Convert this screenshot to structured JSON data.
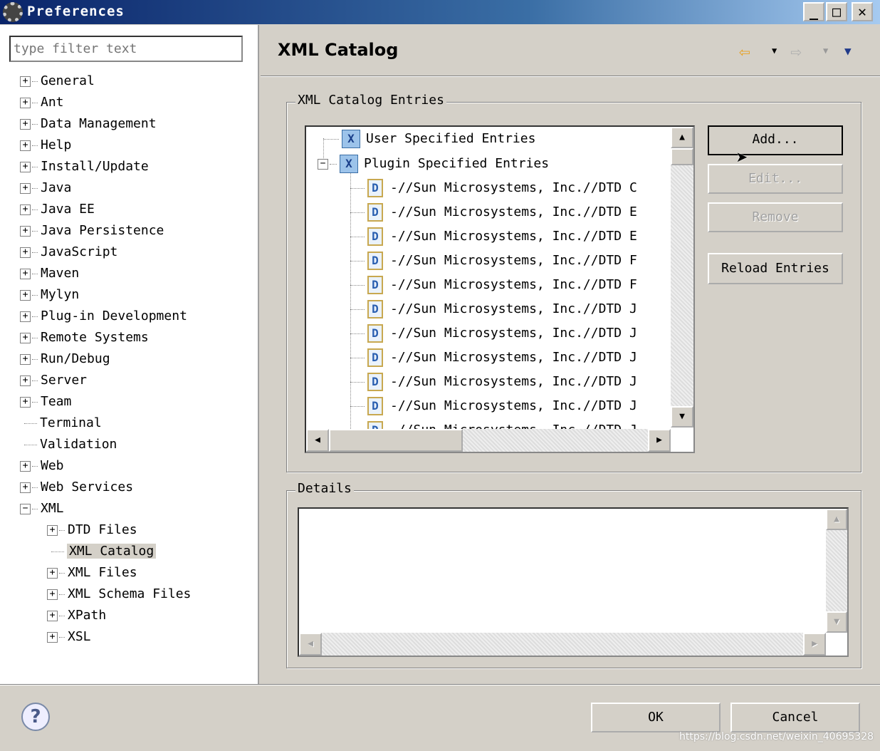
{
  "window": {
    "title": "Preferences",
    "minimize": "_",
    "maximize": "□",
    "close": "✕"
  },
  "sidebar": {
    "filter_placeholder": "type filter text",
    "items": [
      {
        "label": "General",
        "exp": "+"
      },
      {
        "label": "Ant",
        "exp": "+"
      },
      {
        "label": "Data Management",
        "exp": "+"
      },
      {
        "label": "Help",
        "exp": "+"
      },
      {
        "label": "Install/Update",
        "exp": "+"
      },
      {
        "label": "Java",
        "exp": "+"
      },
      {
        "label": "Java EE",
        "exp": "+"
      },
      {
        "label": "Java Persistence",
        "exp": "+"
      },
      {
        "label": "JavaScript",
        "exp": "+"
      },
      {
        "label": "Maven",
        "exp": "+"
      },
      {
        "label": "Mylyn",
        "exp": "+"
      },
      {
        "label": "Plug-in Development",
        "exp": "+"
      },
      {
        "label": "Remote Systems",
        "exp": "+"
      },
      {
        "label": "Run/Debug",
        "exp": "+"
      },
      {
        "label": "Server",
        "exp": "+"
      },
      {
        "label": "Team",
        "exp": "+"
      },
      {
        "label": "Terminal",
        "exp": ""
      },
      {
        "label": "Validation",
        "exp": ""
      },
      {
        "label": "Web",
        "exp": "+"
      },
      {
        "label": "Web Services",
        "exp": "+"
      },
      {
        "label": "XML",
        "exp": "−"
      }
    ],
    "xml_children": [
      {
        "label": "DTD Files",
        "exp": "+"
      },
      {
        "label": "XML Catalog",
        "exp": "",
        "selected": true
      },
      {
        "label": "XML Files",
        "exp": "+"
      },
      {
        "label": "XML Schema Files",
        "exp": "+"
      },
      {
        "label": "XPath",
        "exp": "+"
      },
      {
        "label": "XSL",
        "exp": "+"
      }
    ]
  },
  "main": {
    "title": "XML Catalog",
    "entries_group": "XML Catalog Entries",
    "user_entries": "User Specified Entries",
    "plugin_entries": "Plugin Specified Entries",
    "entries": [
      "-//Sun Microsystems, Inc.//DTD C",
      "-//Sun Microsystems, Inc.//DTD E",
      "-//Sun Microsystems, Inc.//DTD E",
      "-//Sun Microsystems, Inc.//DTD F",
      "-//Sun Microsystems, Inc.//DTD F",
      "-//Sun Microsystems, Inc.//DTD J",
      "-//Sun Microsystems, Inc.//DTD J",
      "-//Sun Microsystems, Inc.//DTD J",
      "-//Sun Microsystems, Inc.//DTD J",
      "-//Sun Microsystems, Inc.//DTD J",
      "-//Sun Microsystems, Inc.//DTD J"
    ],
    "buttons": {
      "add": "Add...",
      "edit": "Edit...",
      "remove": "Remove",
      "reload": "Reload Entries"
    },
    "details_group": "Details"
  },
  "footer": {
    "ok": "OK",
    "cancel": "Cancel",
    "help": "?"
  },
  "watermark": "https://blog.csdn.net/weixin_40695328"
}
